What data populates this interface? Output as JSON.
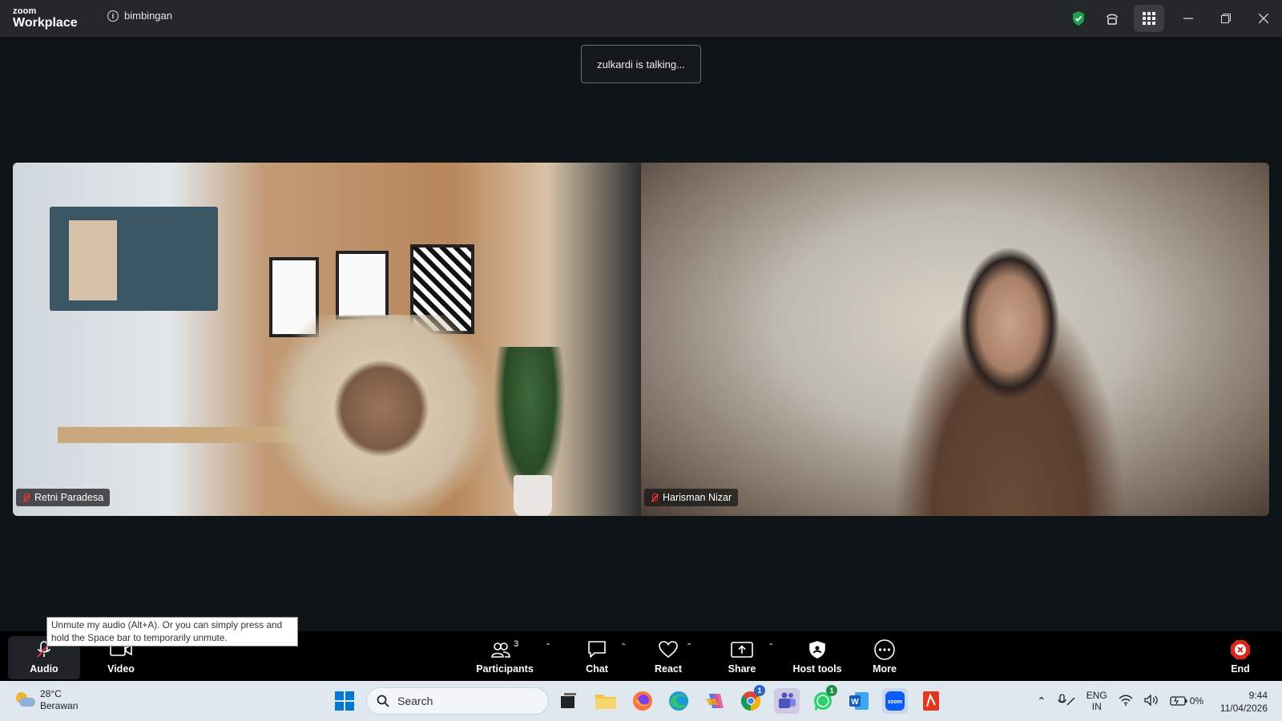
{
  "app": {
    "brand_top": "zoom",
    "brand_bottom": "Workplace",
    "meeting_title": "bimbingan"
  },
  "status": {
    "talking": "zulkardi is talking..."
  },
  "participants": [
    {
      "name": "Retni Paradesa",
      "muted": true
    },
    {
      "name": "Harisman Nizar",
      "muted": true
    }
  ],
  "tooltip": {
    "text_line1": "Unmute my audio (Alt+A). Or you can simply press and",
    "text_line2": "hold the Space bar to temporarily unmute."
  },
  "toolbar": {
    "audio": "Audio",
    "video": "Video",
    "participants": "Participants",
    "participants_count": "3",
    "chat": "Chat",
    "react": "React",
    "share": "Share",
    "host_tools": "Host tools",
    "more": "More",
    "end": "End"
  },
  "taskbar": {
    "weather_temp": "28°C",
    "weather_desc": "Berawan",
    "search_placeholder": "Search",
    "lang_top": "ENG",
    "lang_bottom": "IN",
    "battery": "0%",
    "time": "9:44",
    "date": "11/04/2026",
    "chrome_badge": "1",
    "whatsapp_badge": "1"
  },
  "colors": {
    "accent_green": "#1aa34a",
    "end_red": "#e0261b",
    "zoom_blue": "#0b5cff"
  }
}
